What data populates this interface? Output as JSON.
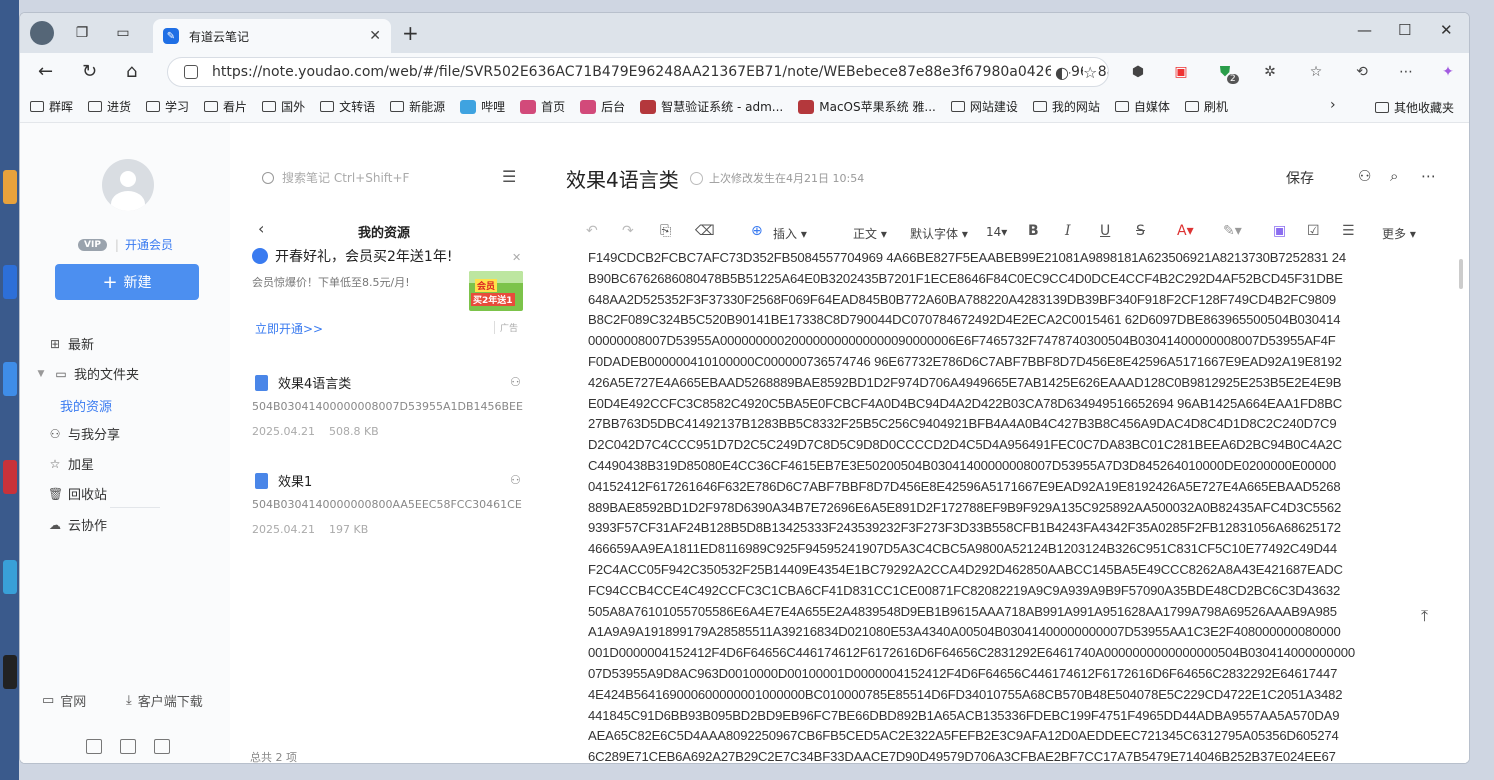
{
  "browser": {
    "tab_title": "有道云笔记",
    "tab_favicon": "youdao-note-icon",
    "url": "https://note.youdao.com/web/#/file/SVR502E636AC71B479E96248AA21367EB71/note/WEBebece87e88e3f67980a0426a496288a0/",
    "extension_badge": "2"
  },
  "bookmarks": [
    "群晖",
    "进货",
    "学习",
    "看片",
    "国外",
    "文转语",
    "新能源",
    "哔哩",
    "首页",
    "后台",
    "智慧验证系统 - adm...",
    "MacOS苹果系统 雅...",
    "网站建设",
    "我的网站",
    "自媒体",
    "刷机"
  ],
  "bookmarks_other": "其他收藏夹",
  "sidebar": {
    "vip_badge": "VIP",
    "open_member": "开通会员",
    "new_button": "新建",
    "items": [
      {
        "label": "最新",
        "icon": "grid-icon"
      },
      {
        "label": "我的文件夹",
        "icon": "folder-icon"
      },
      {
        "label": "我的资源",
        "icon": ""
      },
      {
        "label": "与我分享",
        "icon": "person-icon"
      },
      {
        "label": "加星",
        "icon": "star-icon"
      },
      {
        "label": "回收站",
        "icon": "trash-icon"
      },
      {
        "label": "云协作",
        "icon": "cloud-icon"
      }
    ],
    "bottom_official": "官网",
    "bottom_download": "客户端下载"
  },
  "midpane": {
    "search_placeholder": "搜索笔记 Ctrl+Shift+F",
    "folder_title": "我的资源",
    "promo_title": "开春好礼，会员买2年送1年!",
    "promo_sub": "会员惊爆价！下单低至8.5元/月!",
    "promo_img_tag": "会员",
    "promo_img_tag2": "买2年送1",
    "promo_link": "立即开通>>",
    "ad_label": "广告",
    "notes": [
      {
        "title": "效果4语言类",
        "preview": "504B03041400000008007D53955A1DB1456BEE",
        "date": "2025.04.21",
        "size": "508.8 KB"
      },
      {
        "title": "效果1",
        "preview": "504B0304140000000800AA5EEC58FCC30461CE",
        "date": "2025.04.21",
        "size": "197 KB"
      }
    ],
    "total": "总共 2 项"
  },
  "editor": {
    "title": "效果4语言类",
    "last_edit": "上次修改发生在4月21日 10:54",
    "save_label": "保存",
    "toolbar": {
      "insert": "插入",
      "body": "正文",
      "font": "默认字体",
      "size": "14",
      "more": "更多"
    },
    "lines": [
      "F149CDCB2FCBC7AFC73D352FB5084557704969 4A66BE827F5EAABEB99E21081A9898181A623506921A8213730B7252831 24",
      "B90BC6762686080478B5B51225A64E0B3202435B7201F1ECE8646F84C0EC9CC4D0DCE4CCF4B2C292D4AF52BCD45F31DBE",
      "648AA2D525352F3F37330F2568F069F64EAD845B0B772A60BA788220A4283139DB39BF340F918F2CF128F749CD4B2FC9809",
      "B8C2F089C324B5C520B90141BE17338C8D790044DC070784672492D4E2ECA2C0015461 62D6097DBE863965500504B030414",
      "00000008007D53955A000000000200000000000000090000006E6F7465732F7478740300504B03041400000008007D53955AF4F",
      "F0DADEB000000410100000C000000736574746 96E67732E786D6C7ABF7BBF8D7D456E8E42596A5171667E9EAD92A19E8192",
      "426A5E727E4A665EBAAD5268889BAE8592BD1D2F974D706A4949665E7AB1425E626EAAAD128C0B9812925E253B5E2E4E9B",
      "E0D4E492CCFC3C8582C4920C5BA5E0FCBCF4A0D4BC94D4A2D422B03CA78D634949516652694 96AB1425A664EAA1FD8BC",
      "27BB763D5DBC41492137B1283BB5C8332F25B5C256C9404921BFB4A4A0B4C427B3B8C456A9DAC4D8C4D1D8C2C240D7C9",
      "D2C042D7C4CCC951D7D2C5C249D7C8D5C9D8D0CCCCD2D4C5D4A956491FEC0C7DA83BC01C281BEEA6D2BC94B0C4A2C",
      "C4490438B319D85080E4CC36CF4615EB7E3E50200504B03041400000008007D53955A7D3D845264010000DE0200000E00000",
      "04152412F617261646F632E786D6C7ABF7BBF8D7D456E8E42596A5171667E9EAD92A19E8192426A5E727E4A665EBAAD5268",
      "889BAE8592BD1D2F978D6390A34B7E72696E6A5E891D2F172788EF9B9F929A135C925892AA500032A0B82435AFC4D3C5562",
      "9393F57CF31AF24B128B5D8B13425333F243539232F3F273F3D33B558CFB1B4243FA4342F35A0285F2FB12831056A68625172",
      "466659AA9EA1811ED8116989C925F94595241907D5A3C4CBC5A9800A52124B1203124B326C951C831CF5C10E77492C49D44",
      "F2C4ACC05F942C350532F25B14409E4354E1BC79292A2CCA4D292D462850AABCC145BA5E49CCC8262A8A43E421687EADC",
      "FC94CCB4CCE4C492CCFC3C1CBA6CF41D831CC1CE00871FC82082219A9C9A939A9B9F57090A35BDE48CD2BC6C3D43632",
      "505A8A76101055705586E6A4E7E4A655E2A4839548D9EB1B9615AAA718AB991A991A951628AA1799A798A69526AAAB9A985",
      "A1A9A9A191899179A28585511A39216834D021080E53A4340A00504B03041400000000007D53955AA1C3E2F408000000080000",
      "001D0000004152412F4D6F64656C446174612F6172616D6F64656C2831292E6461740A0000000000000000504B030414000000000",
      "07D53955A9D8AC963D0010000D00100001D0000004152412F4D6F64656C446174612F6172616D6F64656C2832292E64617447",
      "4E424B564169000600000001000000BC010000785E85514D6FD34010755A68CB570B48E504078E5C229CD4722E1C2051A3482",
      "441845C91D6BB93B095BD2BD9EB96FC7BE66DBD892B1A65ACB135336FDEBC199F4751F4965DD44ADBA9557AA5A570DA9",
      "AEA65C82E6C5D4AAA8092250967CB6FB5CED5AC2E322A5FEFB2E3C9AFA12D0AEDDEEC721345C6312795A05356D605274",
      "6C289E71CEB6A692A27B29C2E7C34BF33DAACE7D90D49579D706A3CFBAE2BF7CC17A7B5479E714046B252B37E024EE67"
    ]
  },
  "colors": {
    "accent": "#4c8ff0",
    "link": "#3a7bf0",
    "tabbar": "#dde3ea"
  }
}
